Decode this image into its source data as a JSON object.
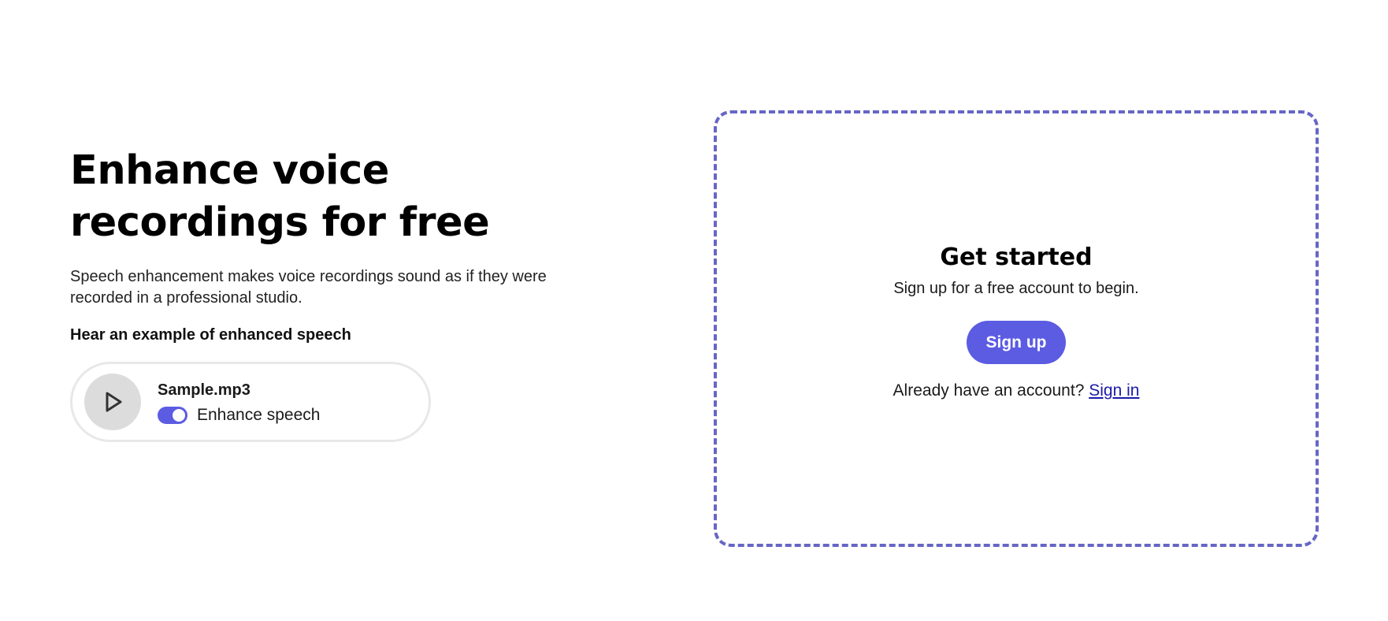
{
  "hero": {
    "title": "Enhance voice recordings for free",
    "description": "Speech enhancement makes voice recordings sound as if they were recorded in a professional studio.",
    "example_label": "Hear an example of enhanced speech"
  },
  "player": {
    "play_icon": "play-icon",
    "file_name": "Sample.mp3",
    "toggle_label": "Enhance speech",
    "toggle_on": true
  },
  "card": {
    "title": "Get started",
    "subtitle": "Sign up for a free account to begin.",
    "signup_label": "Sign up",
    "signin_prompt": "Already have an account?",
    "signin_label": "Sign in"
  },
  "colors": {
    "accent": "#5b5ce2",
    "card_border": "#6666c6",
    "link": "#1a1aa8",
    "play_bg": "#dcdcdc"
  }
}
